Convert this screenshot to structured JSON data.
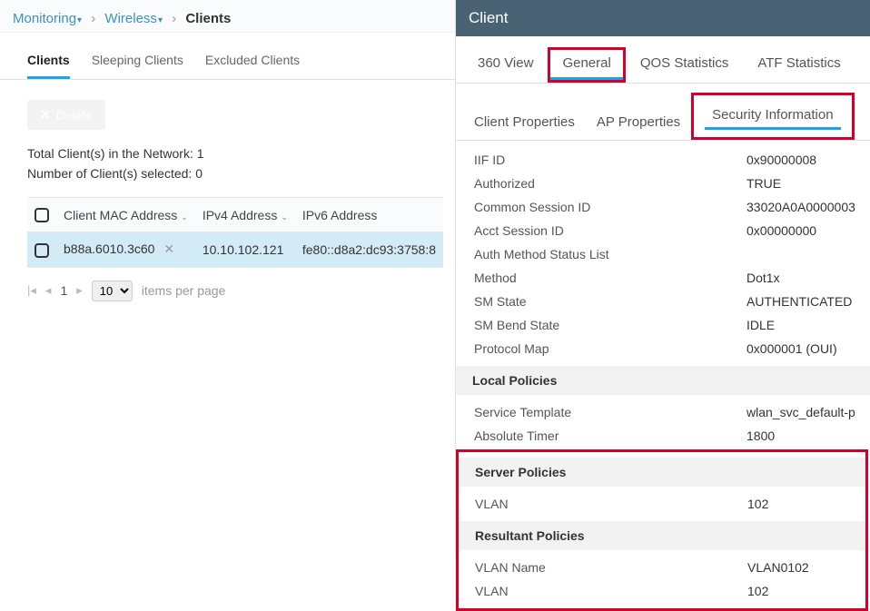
{
  "breadcrumb": {
    "item1": "Monitoring",
    "item2": "Wireless",
    "current": "Clients"
  },
  "leftTabs": {
    "clients": "Clients",
    "sleeping": "Sleeping Clients",
    "excluded": "Excluded Clients"
  },
  "deleteLabel": "Delete",
  "stats": {
    "totalLabel": "Total Client(s) in the Network:",
    "totalValue": "1",
    "selectedLabel": "Number of Client(s) selected:",
    "selectedValue": "0"
  },
  "table": {
    "headers": {
      "mac": "Client MAC Address",
      "ipv4": "IPv4 Address",
      "ipv6": "IPv6 Address"
    },
    "rows": [
      {
        "mac": "b88a.6010.3c60",
        "ipv4": "10.10.102.121",
        "ipv6": "fe80::d8a2:dc93:3758:8"
      }
    ]
  },
  "pager": {
    "page": "1",
    "pageSize": "10",
    "itemsLabel": "items per page"
  },
  "panelTitle": "Client",
  "rightTabs1": {
    "t360": "360 View",
    "general": "General",
    "qos": "QOS Statistics",
    "atf": "ATF Statistics"
  },
  "rightTabs2": {
    "clientProps": "Client Properties",
    "apProps": "AP Properties",
    "security": "Security Information"
  },
  "details": {
    "iifId": {
      "label": "IIF ID",
      "value": "0x90000008"
    },
    "authorized": {
      "label": "Authorized",
      "value": "TRUE"
    },
    "commonSession": {
      "label": "Common Session ID",
      "value": "33020A0A0000003"
    },
    "acctSession": {
      "label": "Acct Session ID",
      "value": "0x00000000"
    },
    "authMethodList": {
      "label": "Auth Method Status List",
      "value": ""
    },
    "method": {
      "label": "Method",
      "value": "Dot1x"
    },
    "smState": {
      "label": "SM State",
      "value": "AUTHENTICATED"
    },
    "smBend": {
      "label": "SM Bend State",
      "value": "IDLE"
    },
    "protocolMap": {
      "label": "Protocol Map",
      "value": "0x000001 (OUI)"
    },
    "localPoliciesHdr": "Local Policies",
    "serviceTemplate": {
      "label": "Service Template",
      "value": "wlan_svc_default-p"
    },
    "absoluteTimer": {
      "label": "Absolute Timer",
      "value": "1800"
    },
    "serverPoliciesHdr": "Server Policies",
    "serverVlan": {
      "label": "VLAN",
      "value": "102"
    },
    "resultantPoliciesHdr": "Resultant Policies",
    "vlanName": {
      "label": "VLAN Name",
      "value": "VLAN0102"
    },
    "resVlan": {
      "label": "VLAN",
      "value": "102"
    }
  }
}
